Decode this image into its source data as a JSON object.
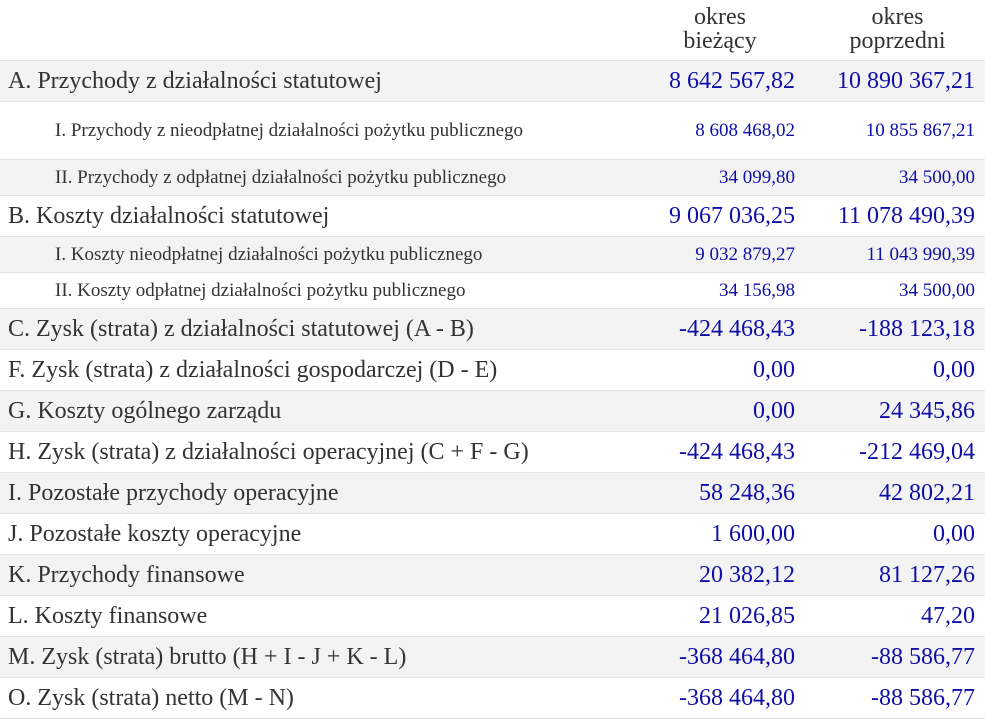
{
  "header": {
    "col_current": "okres\nbieżący",
    "col_previous": "okres\npoprzedni"
  },
  "rows": [
    {
      "label": "A. Przychody z działalności statutowej",
      "current": "8 642 567,82",
      "previous": "10 890 367,21"
    },
    {
      "label": "I. Przychody z nieodpłatnej działalności pożytku publicznego",
      "current": "8 608 468,02",
      "previous": "10 855 867,21"
    },
    {
      "label": "II. Przychody z odpłatnej działalności pożytku publicznego",
      "current": "34 099,80",
      "previous": "34 500,00"
    },
    {
      "label": "B. Koszty działalności statutowej",
      "current": "9 067 036,25",
      "previous": "11 078 490,39"
    },
    {
      "label": "I. Koszty nieodpłatnej działalności pożytku publicznego",
      "current": "9 032 879,27",
      "previous": "11 043 990,39"
    },
    {
      "label": "II. Koszty odpłatnej działalności pożytku publicznego",
      "current": "34 156,98",
      "previous": "34 500,00"
    },
    {
      "label": "C. Zysk (strata) z działalności statutowej (A - B)",
      "current": "-424 468,43",
      "previous": "-188 123,18"
    },
    {
      "label": "F. Zysk (strata) z działalności gospodarczej (D - E)",
      "current": "0,00",
      "previous": "0,00"
    },
    {
      "label": "G. Koszty ogólnego zarządu",
      "current": "0,00",
      "previous": "24 345,86"
    },
    {
      "label": "H. Zysk (strata) z działalności operacyjnej (C + F - G)",
      "current": "-424 468,43",
      "previous": "-212 469,04"
    },
    {
      "label": "I. Pozostałe przychody operacyjne",
      "current": "58 248,36",
      "previous": "42 802,21"
    },
    {
      "label": "J. Pozostałe koszty operacyjne",
      "current": "1 600,00",
      "previous": "0,00"
    },
    {
      "label": "K. Przychody finansowe",
      "current": "20 382,12",
      "previous": "81 127,26"
    },
    {
      "label": "L. Koszty finansowe",
      "current": "21 026,85",
      "previous": "47,20"
    },
    {
      "label": "M. Zysk (strata) brutto (H + I - J + K - L)",
      "current": "-368 464,80",
      "previous": "-88 586,77"
    },
    {
      "label": "O. Zysk (strata) netto (M - N)",
      "current": "-368 464,80",
      "previous": "-88 586,77"
    }
  ],
  "colors": {
    "value_text": "#0f0fa8",
    "label_text": "#333333",
    "shaded_row": "#f3f3f3"
  }
}
